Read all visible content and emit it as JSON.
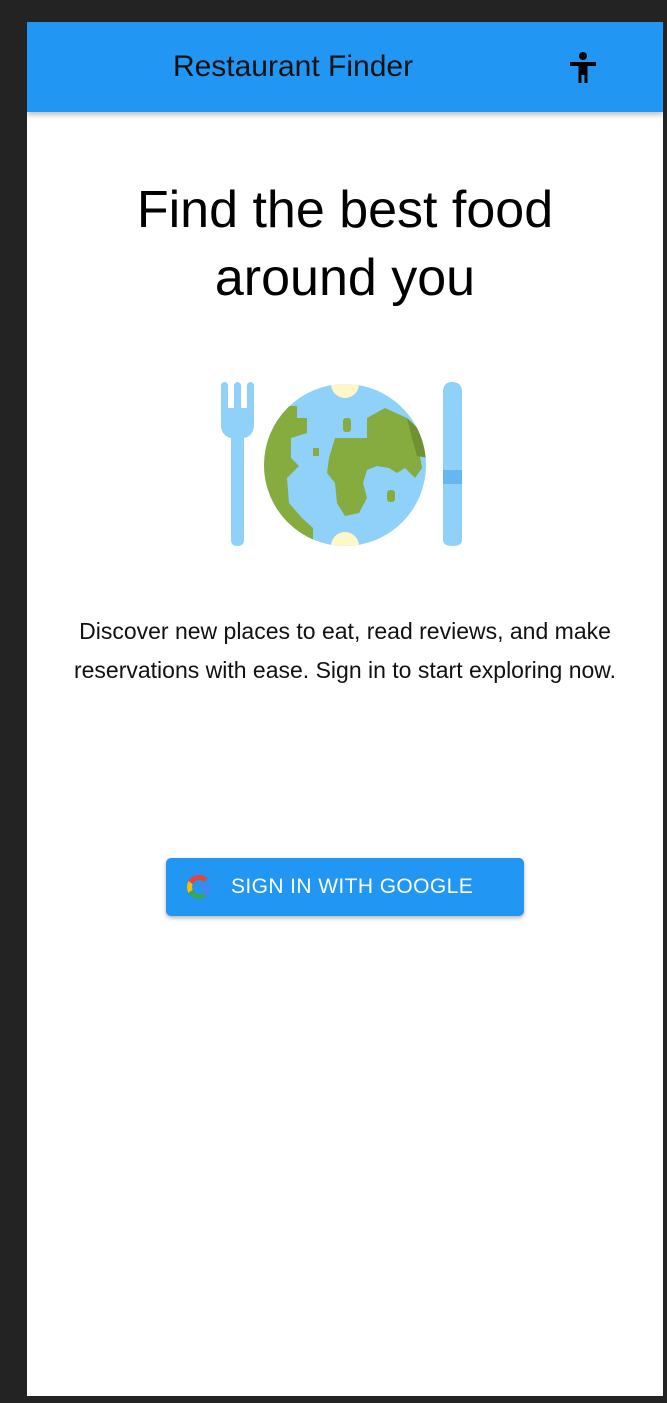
{
  "app_bar": {
    "title": "Restaurant Finder",
    "action_icon": "accessibility-icon",
    "background_color": "#2196f3"
  },
  "main": {
    "headline_line1": "Find the best food",
    "headline_line2": "around you",
    "illustration_icon": "globe-plate-with-fork-and-knife-icon",
    "description": "Discover new places to eat, read reviews, and make reservations with ease. Sign in to start exploring now.",
    "signin_button": {
      "label": "SIGN IN WITH GOOGLE",
      "icon": "google-icon",
      "color": "#2196f3"
    }
  }
}
